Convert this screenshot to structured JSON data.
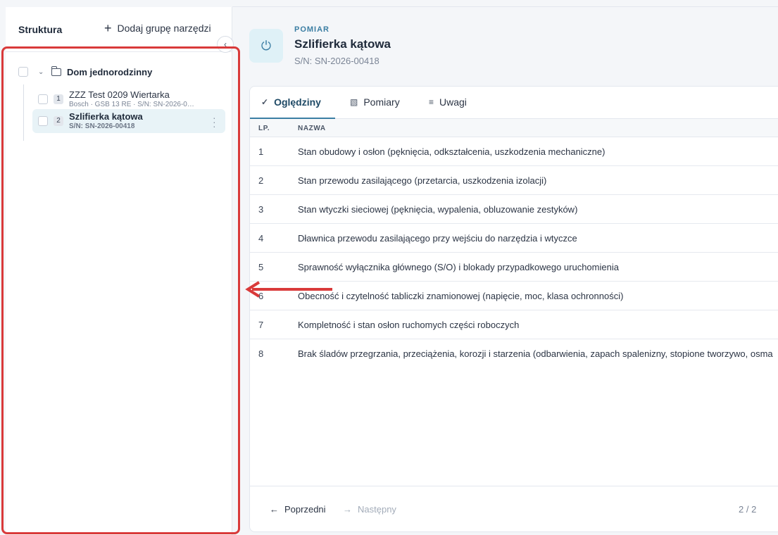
{
  "sidebar": {
    "title": "Struktura",
    "add_group": "Dodaj grupę narzędzi",
    "group": {
      "label": "Dom jednorodzinny"
    },
    "items": [
      {
        "num": "1",
        "name": "ZZZ Test 0209 Wiertarka",
        "sub": "Bosch · GSB 13 RE · S/N: SN-2026-0…"
      },
      {
        "num": "2",
        "name": "Szlifierka kątowa",
        "sub": "S/N: SN-2026-00418"
      }
    ]
  },
  "header": {
    "kicker": "POMIAR",
    "title": "Szlifierka kątowa",
    "sn": "S/N: SN-2026-00418"
  },
  "tabs": [
    {
      "label": "Oględziny",
      "icon": "check-circle-icon"
    },
    {
      "label": "Pomiary",
      "icon": "chart-icon"
    },
    {
      "label": "Uwagi",
      "icon": "lines-icon"
    }
  ],
  "table": {
    "headers": [
      "LP.",
      "NAZWA"
    ],
    "rows": [
      {
        "lp": "1",
        "name": "Stan obudowy i osłon (pęknięcia, odkształcenia, uszkodzenia mechaniczne)"
      },
      {
        "lp": "2",
        "name": "Stan przewodu zasilającego (przetarcia, uszkodzenia izolacji)"
      },
      {
        "lp": "3",
        "name": "Stan wtyczki sieciowej (pęknięcia, wypalenia, obluzowanie zestyków)"
      },
      {
        "lp": "4",
        "name": "Dławnica przewodu zasilającego przy wejściu do narzędzia i wtyczce"
      },
      {
        "lp": "5",
        "name": "Sprawność wyłącznika głównego (S/O) i blokady przypadkowego uruchomienia"
      },
      {
        "lp": "6",
        "name": "Obecność i czytelność tabliczki znamionowej (napięcie, moc, klasa ochronności)"
      },
      {
        "lp": "7",
        "name": "Kompletność i stan osłon ruchomych części roboczych"
      },
      {
        "lp": "8",
        "name": "Brak śladów przegrzania, przeciążenia, korozji i starzenia (odbarwienia, zapach spalenizny, stopione tworzywo, osma"
      }
    ]
  },
  "footer": {
    "prev": "Poprzedni",
    "next": "Następny",
    "pager": "2 / 2"
  },
  "colors": {
    "accent": "#3b7ea3",
    "highlight": "#d93a3a",
    "selected_bg": "#e8f3f7"
  }
}
